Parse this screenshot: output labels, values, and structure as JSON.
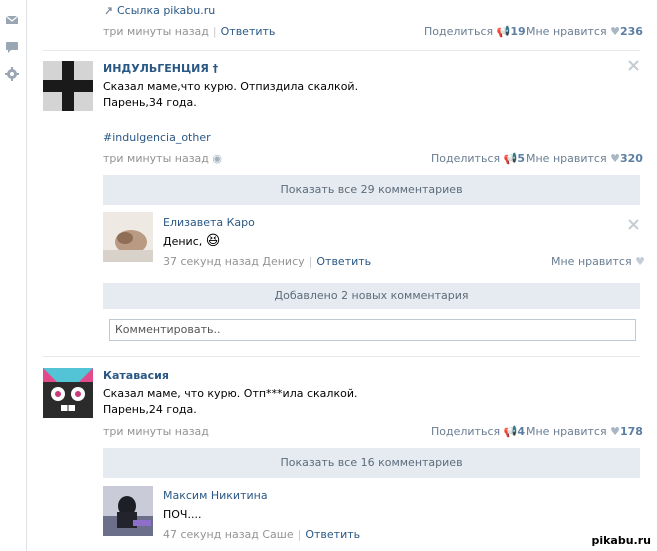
{
  "top_fragment": {
    "link_text": "Ссылка pikabu.ru",
    "time": "три минуты назад",
    "reply": "Ответить",
    "share": "Поделиться",
    "share_count": "19",
    "like": "Мне нравится",
    "like_count": "236"
  },
  "post1": {
    "author": "ИНДУЛЬГЕНЦИЯ †",
    "line1": "Сказал маме,что курю. Отпиздила скалкой.",
    "line2": "Парень,34 года.",
    "hashtag": "#indulgencia_other",
    "time": "три минуты назад",
    "device_icon": "android-icon",
    "share": "Поделиться",
    "share_count": "5",
    "like": "Мне нравится",
    "like_count": "320",
    "show_comments": "Показать все 29 комментариев",
    "comment": {
      "author": "Елизавета Каро",
      "text": "Денис,",
      "emoji": "😆",
      "time": "37 секунд назад Денису",
      "reply": "Ответить",
      "like": "Мне нравится"
    },
    "new_comments": "Добавлено 2 новых комментария",
    "comment_placeholder": "Комментировать.."
  },
  "post2": {
    "author": "Катавасия",
    "line1": "Сказал маме, что курю. Отп***ила скалкой.",
    "line2": "Парень,24 года.",
    "time": "три минуты назад",
    "share": "Поделиться",
    "share_count": "4",
    "like": "Мне нравится",
    "like_count": "178",
    "show_comments": "Показать все 16 комментариев",
    "comment": {
      "author": "Максим Никитина",
      "text": "ПОЧ....",
      "time": "47 секунд назад Саше",
      "reply": "Ответить"
    }
  },
  "watermark": "pikabu.ru",
  "colors": {
    "link": "#2a5885",
    "bar_bg": "#e5ebf1",
    "muted": "#939393"
  }
}
